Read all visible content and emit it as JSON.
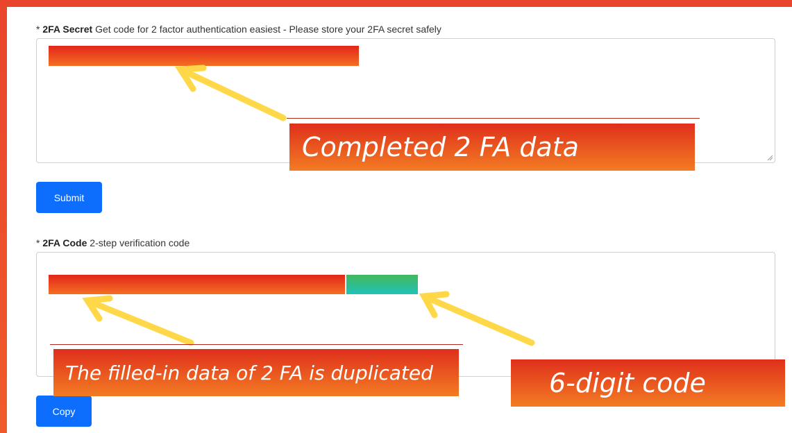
{
  "secret_field": {
    "required_mark": "*",
    "label_bold": "2FA Secret",
    "label_desc": "Get code for 2 factor authentication easiest - Please store your 2FA secret safely"
  },
  "submit_button": {
    "label": "Submit"
  },
  "code_field": {
    "required_mark": "*",
    "label_bold": "2FA Code",
    "label_desc": "2-step verification code"
  },
  "copy_button": {
    "label": "Copy"
  },
  "annotations": {
    "secret_callout": "Completed 2 FA data",
    "duplicate_callout": "The filled-in data of 2 FA is duplicated",
    "code_callout": "6-digit code"
  },
  "colors": {
    "accent_frame": "#e9452d",
    "button_blue": "#0d6efd",
    "arrow_yellow": "#ffd84a",
    "redaction_red": "#e2261a",
    "redaction_green": "#34c08a"
  }
}
